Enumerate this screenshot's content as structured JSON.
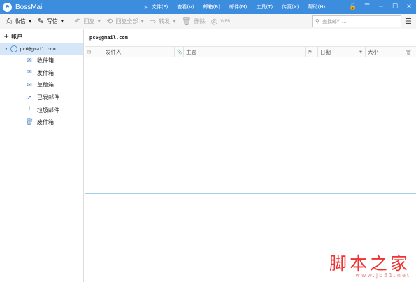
{
  "app": {
    "title": "BossMail",
    "logo_letter": "e"
  },
  "menu": {
    "more": "»",
    "items": [
      "文件(F)",
      "查看(V)",
      "邮箱(B)",
      "邮件(M)",
      "工具(T)",
      "传真(X)",
      "帮助(H)"
    ]
  },
  "window_controls": [
    "🔒",
    "☰",
    "─",
    "☐",
    "✕"
  ],
  "toolbar": {
    "receive": "收信",
    "compose": "写信",
    "reply": "回复",
    "reply_all": "回复全部",
    "forward": "转发",
    "delete": "删除",
    "web": "WEB"
  },
  "search": {
    "placeholder": "查找邮件..."
  },
  "sidebar": {
    "header": "帐户",
    "account": "pc6@gmail.com",
    "folders": [
      {
        "label": "收件箱",
        "icon": "inbox-icon",
        "glyph": "✉"
      },
      {
        "label": "发件箱",
        "icon": "outbox-icon",
        "glyph": "✉"
      },
      {
        "label": "草稿箱",
        "icon": "drafts-icon",
        "glyph": "✉"
      },
      {
        "label": "已发邮件",
        "icon": "sent-icon",
        "glyph": "➚"
      },
      {
        "label": "垃圾邮件",
        "icon": "junk-icon",
        "glyph": "!"
      },
      {
        "label": "废件箱",
        "icon": "trash-icon",
        "glyph": "🗑"
      }
    ]
  },
  "main": {
    "account_title": "pc6@gmail.com",
    "columns": {
      "type_icon": "✉",
      "sender": "发件人",
      "attachment_icon": "📎",
      "subject": "主题",
      "flag_icon": "⚑",
      "date": "日期",
      "size": "大小",
      "delete_icon": "🗑"
    }
  },
  "watermark": {
    "text": "脚本之家",
    "url": "www.jb51.net"
  },
  "colors": {
    "titlebar": "#3d8ddf",
    "selected": "#d4e6f8",
    "watermark": "#e33333"
  }
}
